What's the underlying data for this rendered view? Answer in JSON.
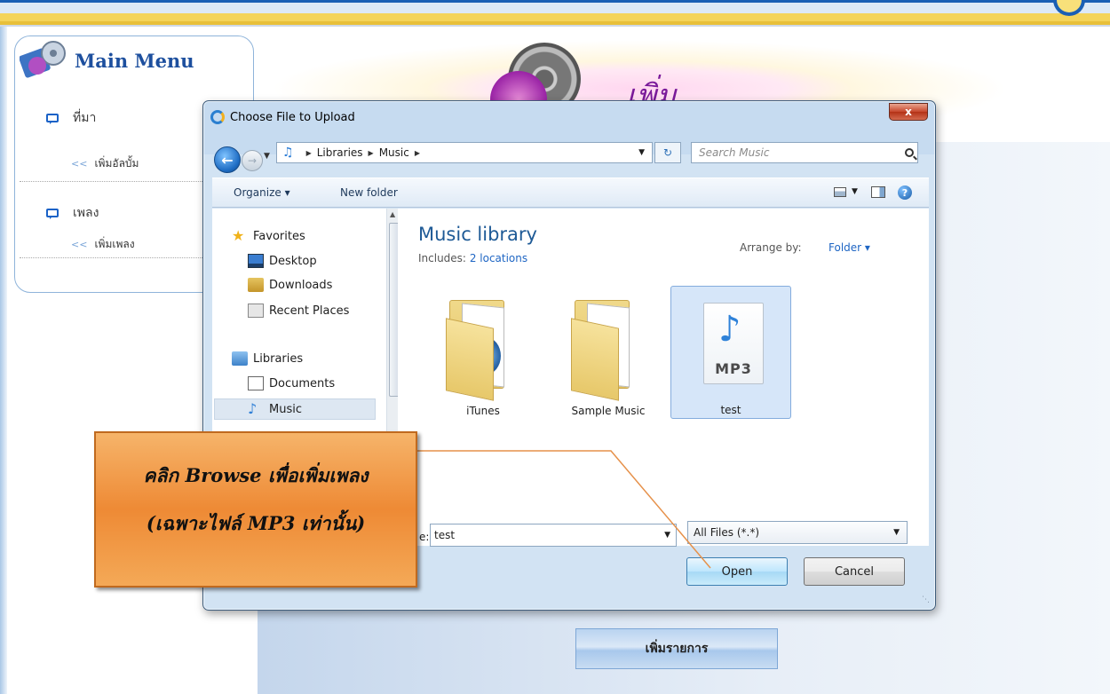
{
  "page": {
    "menu_title": "Main Menu",
    "menu": [
      {
        "heading": "ที่มา",
        "sub": "เพิ่มอัลบั้ม"
      },
      {
        "heading": "เพลง",
        "sub": "เพิ่มเพลง"
      }
    ],
    "chevron": "<<",
    "header_word": "เพิ่ม",
    "add_button": "เพิ่มรายการ"
  },
  "dialog": {
    "title": "Choose File to Upload",
    "close_label": "x",
    "address": {
      "part1": "Libraries",
      "part2": "Music"
    },
    "search_placeholder": "Search Music",
    "toolbar": {
      "organize": "Organize ▾",
      "new_folder": "New folder"
    },
    "nav": {
      "favorites": "Favorites",
      "desktop": "Desktop",
      "downloads": "Downloads",
      "recent": "Recent Places",
      "libraries": "Libraries",
      "documents": "Documents",
      "music": "Music"
    },
    "library": {
      "title": "Music library",
      "includes_label": "Includes:",
      "includes_link": "2 locations",
      "arrange_label": "Arrange by:",
      "arrange_value": "Folder ▾"
    },
    "files": [
      {
        "name": "iTunes"
      },
      {
        "name": "Sample Music"
      },
      {
        "name": "test",
        "badge": "MP3"
      }
    ],
    "filename_label": "e:",
    "filename_value": "test",
    "filter_value": "All Files (*.*)",
    "open_label": "Open",
    "cancel_label": "Cancel"
  },
  "callout": {
    "line1": "คลิก Browse เพื่อเพิ่มเพลง",
    "line2": "(เฉพาะไฟล์ MP3 เท่านั้น)"
  },
  "colors": {
    "accent": "#1a5fb4",
    "callout": "#ee8a35",
    "link": "#1f66c4"
  }
}
